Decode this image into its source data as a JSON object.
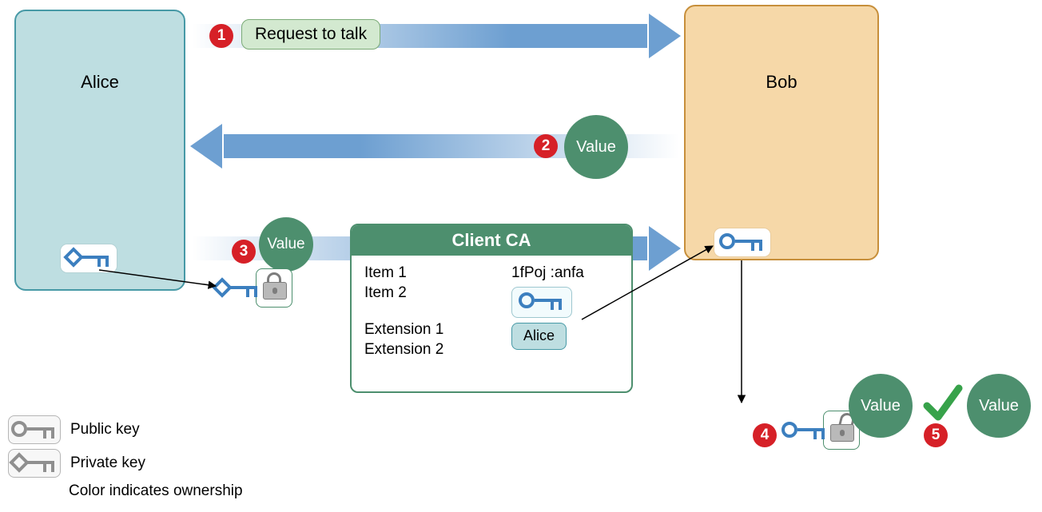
{
  "principals": {
    "alice": "Alice",
    "bob": "Bob"
  },
  "steps": {
    "s1": {
      "num": "1",
      "label": "Request to talk"
    },
    "s2": {
      "num": "2",
      "token": "Value"
    },
    "s3": {
      "num": "3",
      "token": "Value"
    },
    "s4": {
      "num": "4",
      "token": "Value"
    },
    "s5": {
      "num": "5",
      "token": "Value"
    }
  },
  "ca": {
    "title": "Client CA",
    "left_items": [
      "Item 1",
      "Item 2"
    ],
    "left_ext": [
      "Extension 1",
      "Extension 2"
    ],
    "right_code": "1fPoj :anfa",
    "subject_chip": "Alice"
  },
  "legend": {
    "public": "Public key",
    "private": "Private key",
    "note": "Color indicates ownership"
  }
}
